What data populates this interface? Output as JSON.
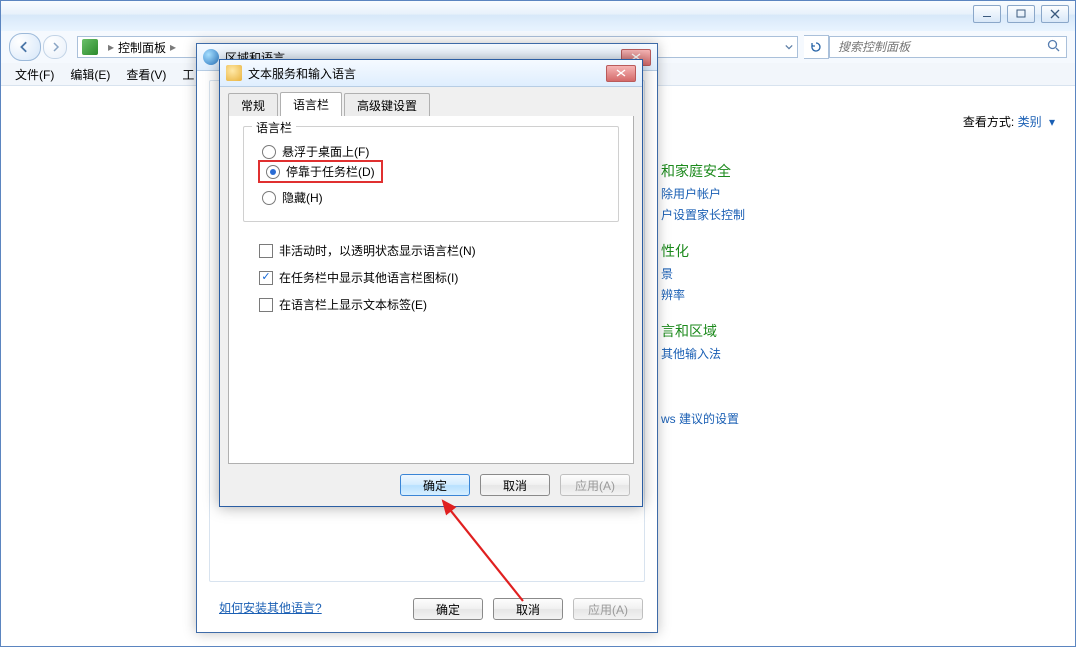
{
  "parent_window": {
    "breadcrumb": {
      "root_icon": "control-panel-icon",
      "item1": "控制面板",
      "sep": "▸"
    },
    "search_placeholder": "搜索控制面板",
    "menubar": {
      "file": "文件(F)",
      "edit": "编辑(E)",
      "view": "查看(V)",
      "tools_initial": "工"
    },
    "view_label": "查看方式:",
    "view_value": "类别",
    "categories": {
      "c1_head": "和家庭安全",
      "c1_l1": "除用户帐户",
      "c1_l2": "户设置家长控制",
      "c2_head": "性化",
      "c2_l1": "景",
      "c2_l2": "辨率",
      "c3_head": "言和区域",
      "c3_l1": "其他输入法",
      "c4_l1": "ws 建议的设置"
    }
  },
  "dlg_region": {
    "title": "区域和语言",
    "link": "如何安装其他语言?",
    "ok": "确定",
    "cancel": "取消",
    "apply": "应用(A)"
  },
  "dlg_text": {
    "title": "文本服务和输入语言",
    "tabs": {
      "t1": "常规",
      "t2": "语言栏",
      "t3": "高级键设置"
    },
    "group_legend": "语言栏",
    "radios": {
      "r1": "悬浮于桌面上(F)",
      "r2": "停靠于任务栏(D)",
      "r3": "隐藏(H)"
    },
    "checks": {
      "c1": "非活动时，以透明状态显示语言栏(N)",
      "c2": "在任务栏中显示其他语言栏图标(I)",
      "c3": "在语言栏上显示文本标签(E)"
    },
    "ok": "确定",
    "cancel": "取消",
    "apply": "应用(A)"
  }
}
